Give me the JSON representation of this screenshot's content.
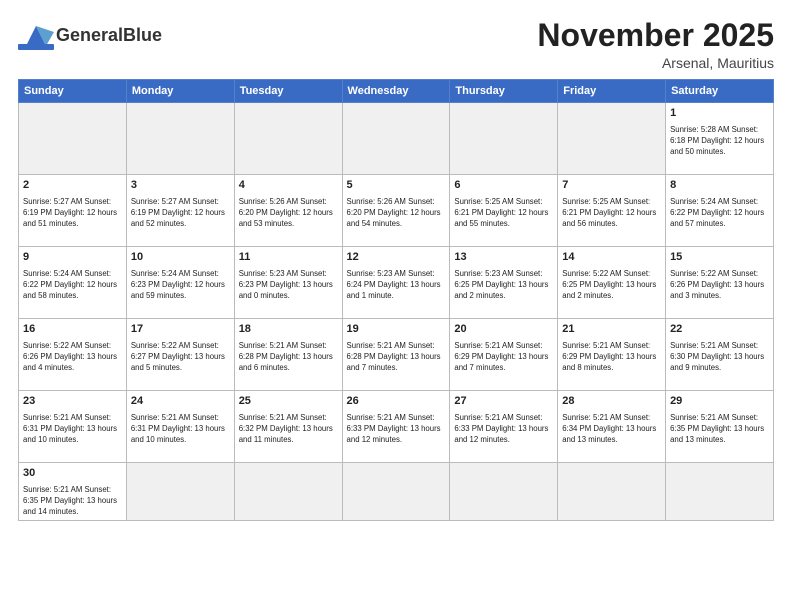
{
  "header": {
    "logo_text_regular": "General",
    "logo_text_bold": "Blue",
    "title": "November 2025",
    "subtitle": "Arsenal, Mauritius"
  },
  "weekdays": [
    "Sunday",
    "Monday",
    "Tuesday",
    "Wednesday",
    "Thursday",
    "Friday",
    "Saturday"
  ],
  "weeks": [
    [
      {
        "day": "",
        "info": ""
      },
      {
        "day": "",
        "info": ""
      },
      {
        "day": "",
        "info": ""
      },
      {
        "day": "",
        "info": ""
      },
      {
        "day": "",
        "info": ""
      },
      {
        "day": "",
        "info": ""
      },
      {
        "day": "1",
        "info": "Sunrise: 5:28 AM\nSunset: 6:18 PM\nDaylight: 12 hours\nand 50 minutes."
      }
    ],
    [
      {
        "day": "2",
        "info": "Sunrise: 5:27 AM\nSunset: 6:19 PM\nDaylight: 12 hours\nand 51 minutes."
      },
      {
        "day": "3",
        "info": "Sunrise: 5:27 AM\nSunset: 6:19 PM\nDaylight: 12 hours\nand 52 minutes."
      },
      {
        "day": "4",
        "info": "Sunrise: 5:26 AM\nSunset: 6:20 PM\nDaylight: 12 hours\nand 53 minutes."
      },
      {
        "day": "5",
        "info": "Sunrise: 5:26 AM\nSunset: 6:20 PM\nDaylight: 12 hours\nand 54 minutes."
      },
      {
        "day": "6",
        "info": "Sunrise: 5:25 AM\nSunset: 6:21 PM\nDaylight: 12 hours\nand 55 minutes."
      },
      {
        "day": "7",
        "info": "Sunrise: 5:25 AM\nSunset: 6:21 PM\nDaylight: 12 hours\nand 56 minutes."
      },
      {
        "day": "8",
        "info": "Sunrise: 5:24 AM\nSunset: 6:22 PM\nDaylight: 12 hours\nand 57 minutes."
      }
    ],
    [
      {
        "day": "9",
        "info": "Sunrise: 5:24 AM\nSunset: 6:22 PM\nDaylight: 12 hours\nand 58 minutes."
      },
      {
        "day": "10",
        "info": "Sunrise: 5:24 AM\nSunset: 6:23 PM\nDaylight: 12 hours\nand 59 minutes."
      },
      {
        "day": "11",
        "info": "Sunrise: 5:23 AM\nSunset: 6:23 PM\nDaylight: 13 hours\nand 0 minutes."
      },
      {
        "day": "12",
        "info": "Sunrise: 5:23 AM\nSunset: 6:24 PM\nDaylight: 13 hours\nand 1 minute."
      },
      {
        "day": "13",
        "info": "Sunrise: 5:23 AM\nSunset: 6:25 PM\nDaylight: 13 hours\nand 2 minutes."
      },
      {
        "day": "14",
        "info": "Sunrise: 5:22 AM\nSunset: 6:25 PM\nDaylight: 13 hours\nand 2 minutes."
      },
      {
        "day": "15",
        "info": "Sunrise: 5:22 AM\nSunset: 6:26 PM\nDaylight: 13 hours\nand 3 minutes."
      }
    ],
    [
      {
        "day": "16",
        "info": "Sunrise: 5:22 AM\nSunset: 6:26 PM\nDaylight: 13 hours\nand 4 minutes."
      },
      {
        "day": "17",
        "info": "Sunrise: 5:22 AM\nSunset: 6:27 PM\nDaylight: 13 hours\nand 5 minutes."
      },
      {
        "day": "18",
        "info": "Sunrise: 5:21 AM\nSunset: 6:28 PM\nDaylight: 13 hours\nand 6 minutes."
      },
      {
        "day": "19",
        "info": "Sunrise: 5:21 AM\nSunset: 6:28 PM\nDaylight: 13 hours\nand 7 minutes."
      },
      {
        "day": "20",
        "info": "Sunrise: 5:21 AM\nSunset: 6:29 PM\nDaylight: 13 hours\nand 7 minutes."
      },
      {
        "day": "21",
        "info": "Sunrise: 5:21 AM\nSunset: 6:29 PM\nDaylight: 13 hours\nand 8 minutes."
      },
      {
        "day": "22",
        "info": "Sunrise: 5:21 AM\nSunset: 6:30 PM\nDaylight: 13 hours\nand 9 minutes."
      }
    ],
    [
      {
        "day": "23",
        "info": "Sunrise: 5:21 AM\nSunset: 6:31 PM\nDaylight: 13 hours\nand 10 minutes."
      },
      {
        "day": "24",
        "info": "Sunrise: 5:21 AM\nSunset: 6:31 PM\nDaylight: 13 hours\nand 10 minutes."
      },
      {
        "day": "25",
        "info": "Sunrise: 5:21 AM\nSunset: 6:32 PM\nDaylight: 13 hours\nand 11 minutes."
      },
      {
        "day": "26",
        "info": "Sunrise: 5:21 AM\nSunset: 6:33 PM\nDaylight: 13 hours\nand 12 minutes."
      },
      {
        "day": "27",
        "info": "Sunrise: 5:21 AM\nSunset: 6:33 PM\nDaylight: 13 hours\nand 12 minutes."
      },
      {
        "day": "28",
        "info": "Sunrise: 5:21 AM\nSunset: 6:34 PM\nDaylight: 13 hours\nand 13 minutes."
      },
      {
        "day": "29",
        "info": "Sunrise: 5:21 AM\nSunset: 6:35 PM\nDaylight: 13 hours\nand 13 minutes."
      }
    ],
    [
      {
        "day": "30",
        "info": "Sunrise: 5:21 AM\nSunset: 6:35 PM\nDaylight: 13 hours\nand 14 minutes."
      },
      {
        "day": "",
        "info": ""
      },
      {
        "day": "",
        "info": ""
      },
      {
        "day": "",
        "info": ""
      },
      {
        "day": "",
        "info": ""
      },
      {
        "day": "",
        "info": ""
      },
      {
        "day": "",
        "info": ""
      }
    ]
  ]
}
